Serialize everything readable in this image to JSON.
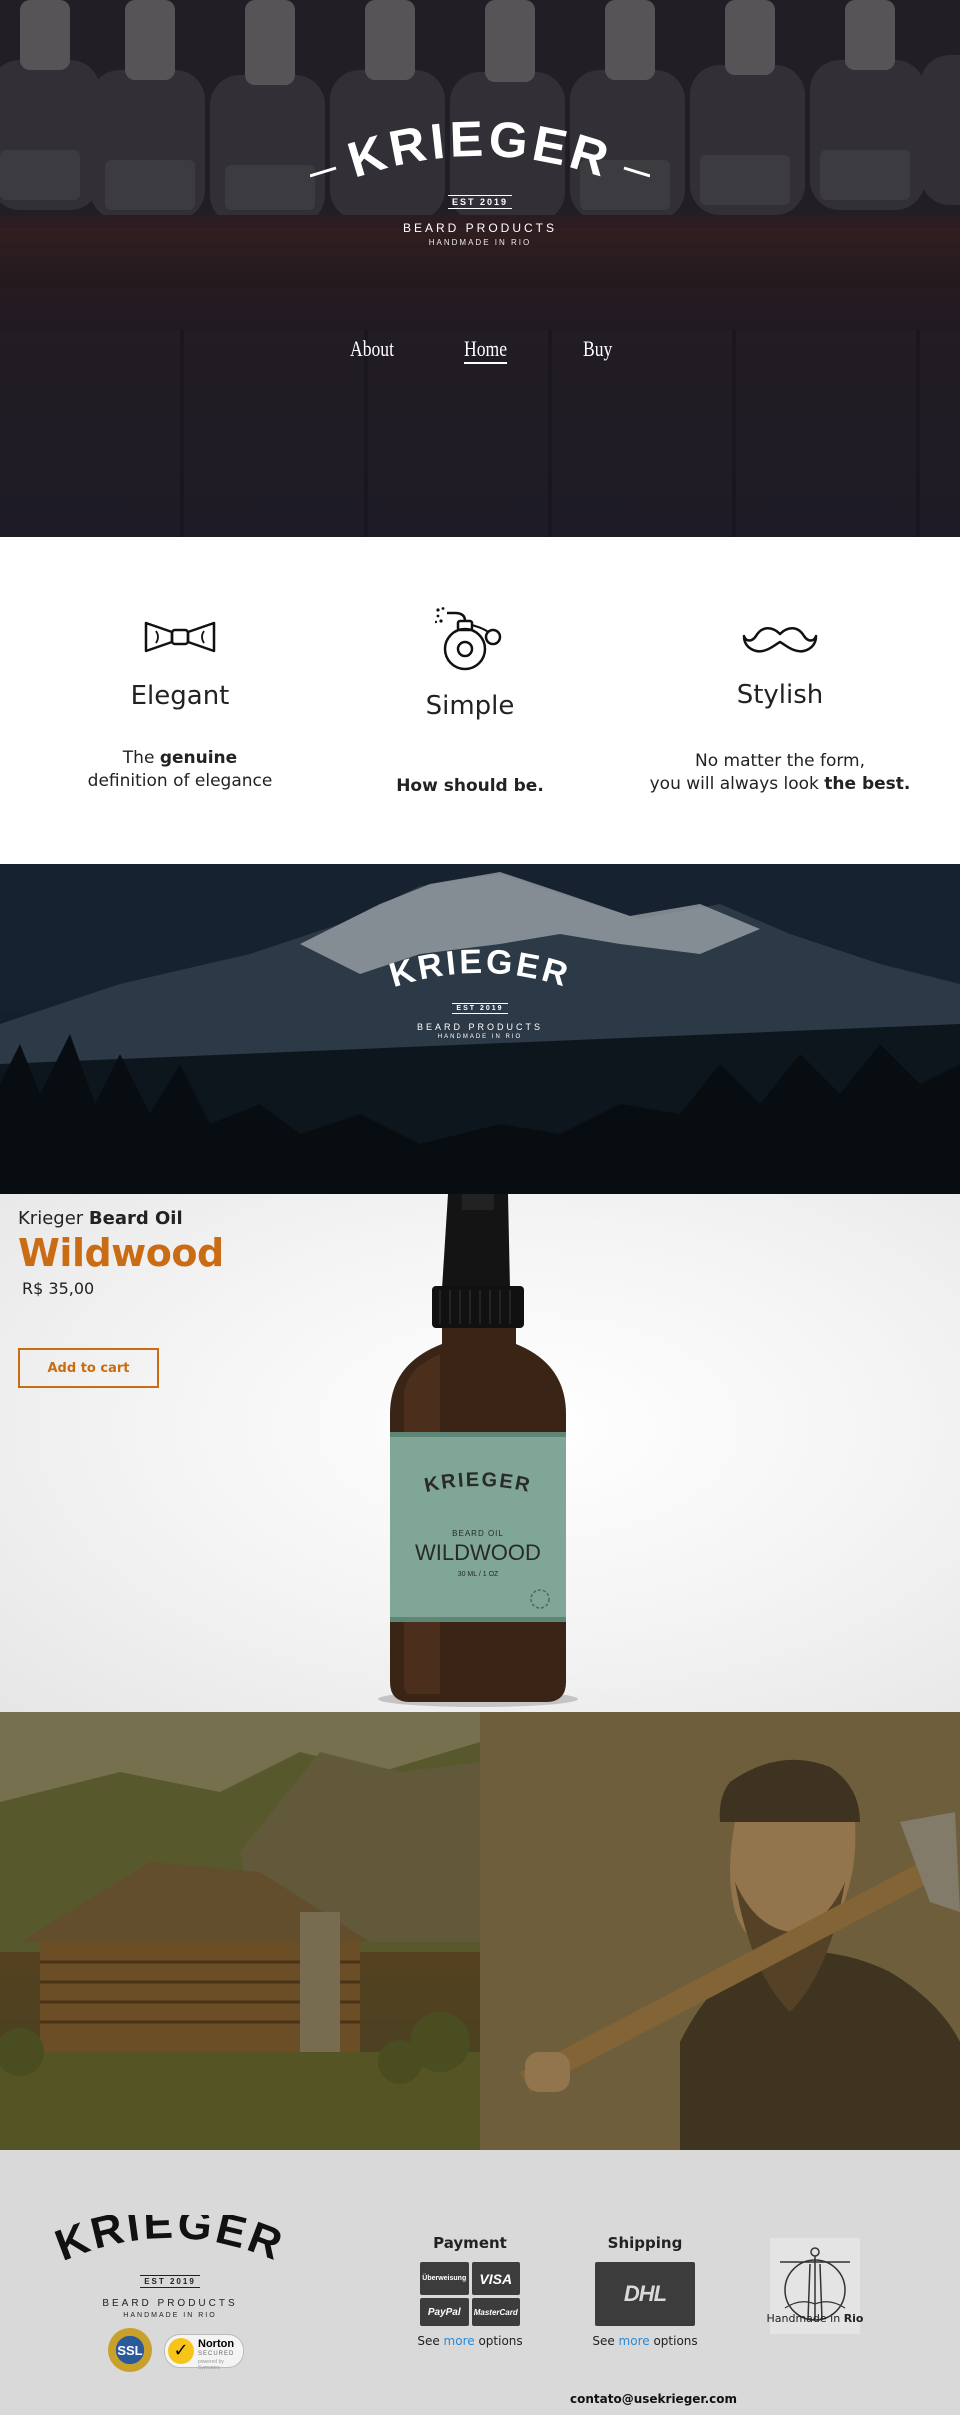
{
  "brand": {
    "name": "KRIEGER",
    "est": "EST 2019",
    "tagline": "BEARD PRODUCTS",
    "handmade": "HANDMADE IN RIO"
  },
  "nav": {
    "items": [
      {
        "label": "About"
      },
      {
        "label": "Home",
        "active": true
      },
      {
        "label": "Buy"
      }
    ]
  },
  "features": [
    {
      "title": "Elegant",
      "icon": "bow-tie-icon",
      "text_pre": "The ",
      "text_bold": "genuine",
      "text_line2": "definition of elegance"
    },
    {
      "title": "Simple",
      "icon": "perfume-bottle-icon",
      "text_bold": "How should be."
    },
    {
      "title": "Stylish",
      "icon": "mustache-icon",
      "text_line1": "No matter the form,",
      "text_pre": "you will always look ",
      "text_bold": "the best."
    }
  ],
  "product": {
    "line_prefix": "Krieger ",
    "line_bold": "Beard Oil",
    "name": "Wildwood",
    "price": "R$ 35,00",
    "cart_label": "Add to cart",
    "accent_color": "#c96c14",
    "label": {
      "brand": "KRIEGER",
      "type": "BEARD OIL",
      "name": "WILDWOOD",
      "size": "30 ML / 1 OZ",
      "label_color": "#7fa697"
    }
  },
  "footer": {
    "payment_title": "Payment",
    "payment_cards": [
      "Überweisung",
      "VISA",
      "PayPal",
      "MasterCard"
    ],
    "shipping_title": "Shipping",
    "shipping_carrier": "DHL",
    "see": "See ",
    "more": "more",
    "options": " options",
    "rio_pre": "Handmade in ",
    "rio_bold": "Rio",
    "badges": {
      "ssl": "SSL",
      "norton": "Norton",
      "norton_sub": "SECURED",
      "norton_by": "powered by Symantec"
    },
    "email": "contato@usekrieger.com"
  }
}
